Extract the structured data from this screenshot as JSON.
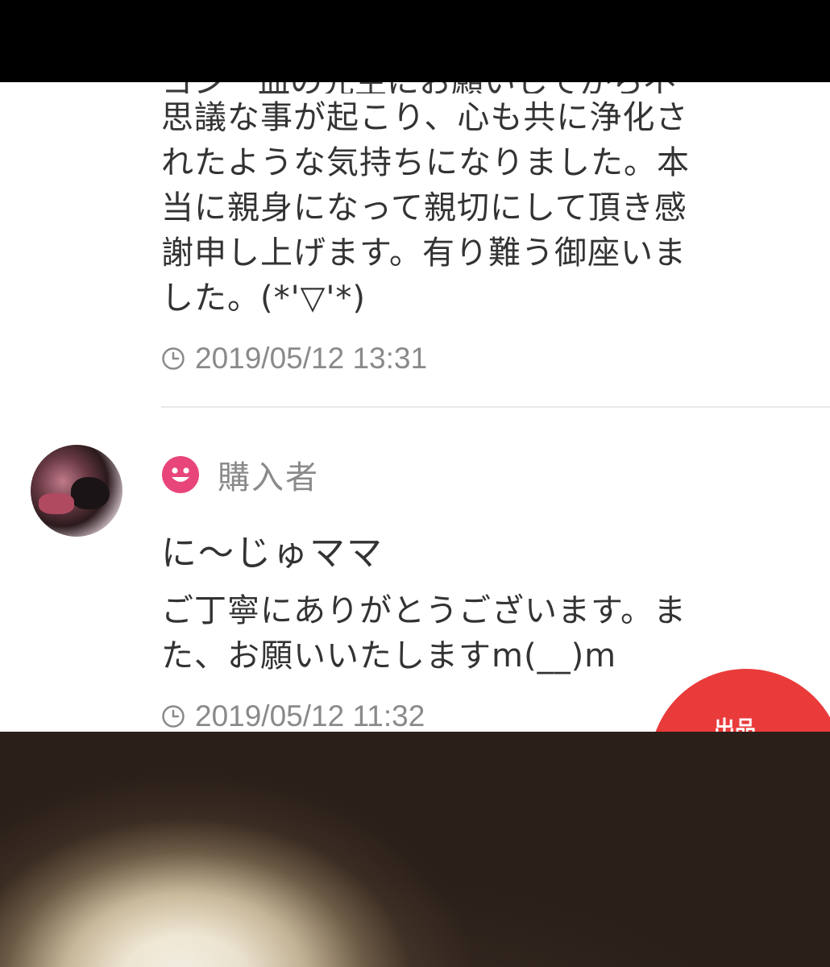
{
  "previous_message": {
    "cut_line": "ヨン　皿の先生にお願いしてから不",
    "lines": [
      "思議な事が起こり、心も共に浄化さ",
      "れたような気持ちになりました。本",
      "当に親身になって親切にして頂き感",
      "謝申し上げます。有り難う御座いま",
      "した。(*'▽'*)"
    ],
    "timestamp": "2019/05/12 13:31"
  },
  "reply": {
    "role": "購入者",
    "username": "に〜じゅママ",
    "lines": [
      "ご丁寧にありがとうございます。ま",
      "た、お願いいたしますm(__)m"
    ],
    "timestamp": "2019/05/12 11:32"
  },
  "sell_button": {
    "label": "出品"
  },
  "colors": {
    "accent_pink": "#e8467a",
    "sell_red": "#ea3b3b",
    "text": "#333333",
    "meta": "#8a8a8a"
  },
  "icons": {
    "timestamp": "clock-icon",
    "role": "smile-icon"
  }
}
